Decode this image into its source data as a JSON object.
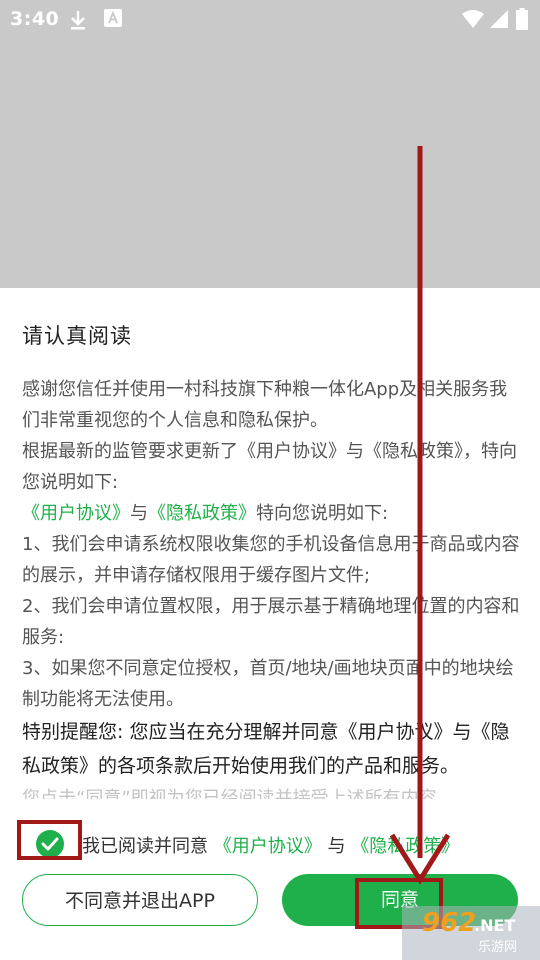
{
  "status_bar": {
    "time": "3:40",
    "icons": [
      "download-icon",
      "a-notification-icon",
      "wifi-icon",
      "signal-icon",
      "battery-icon"
    ]
  },
  "dialog": {
    "title": "请认真阅读",
    "para1": "感谢您信任并使用一村科技旗下种粮一体化App及相关服务我们非常重视您的个人信息和隐私保护。",
    "para2": "根据最新的监管要求更新了《用户协议》与《隐私政策》，特向您说明如下:",
    "links_line": {
      "user_agreement": "《用户协议》",
      "and": "与",
      "privacy_policy": "《隐私政策》",
      "suffix": "特向您说明如下:"
    },
    "item1": "1、我们会申请系统权限收集您的手机设备信息用于商品或内容的展示，并申请存储权限用于缓存图片文件;",
    "item2": "2、我们会申请位置权限，用于展示基于精确地理位置的内容和服务:",
    "item3": "3、如果您不同意定位授权，首页/地块/画地块页面中的地块绘制功能将无法使用。",
    "notice": "特别提醒您: 您应当在充分理解并同意《用户协议》与《隐私政策》的各项条款后开始使用我们的产品和服务。",
    "faded_line": "您点击“同意”即视为您已经阅读并接受上述所有内容"
  },
  "consent": {
    "checked": true,
    "prefix": "我已阅读并同意",
    "user_agreement": "《用户协议》",
    "and": "与",
    "privacy_policy": "《隐私政策》"
  },
  "buttons": {
    "decline_label": "不同意并退出APP",
    "agree_label": "同意"
  },
  "watermark": {
    "number": "962",
    "suffix": ".NET",
    "sub": "乐游网"
  },
  "colors": {
    "accent": "#20b04b",
    "annotation": "#a01818",
    "backdrop": "#c9c9c9"
  }
}
